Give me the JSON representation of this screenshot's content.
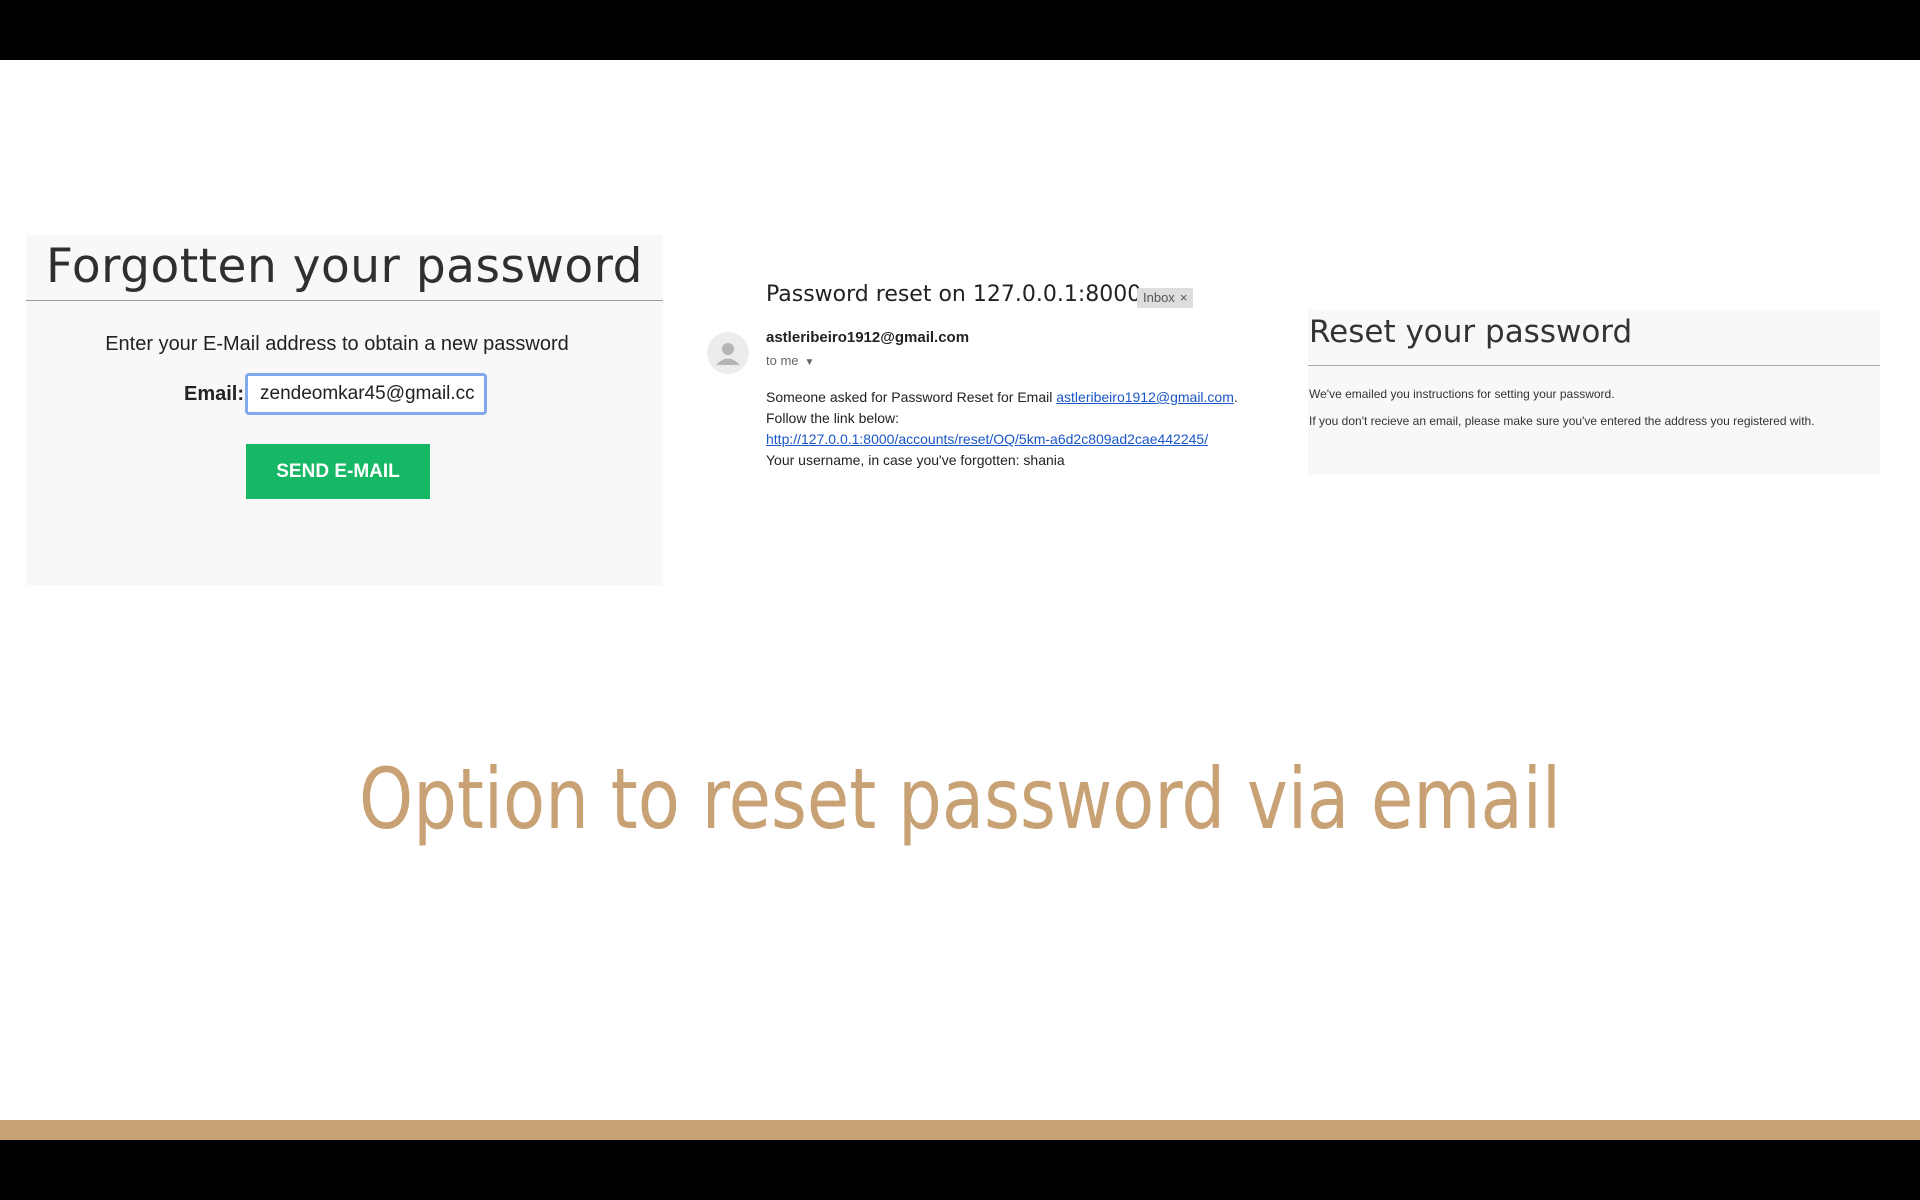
{
  "forgot_panel": {
    "title": "Forgotten your password",
    "instruction": "Enter your E-Mail address to obtain a new password",
    "email_label": "Email:",
    "email_value": "zendeomkar45@gmail.cc",
    "send_button": "SEND E-MAIL",
    "colors": {
      "button": "#17b865",
      "input_focus": "#7fa9e8"
    }
  },
  "email_panel": {
    "subject": "Password reset on 127.0.0.1:8000",
    "tag": "Inbox",
    "tag_close": "×",
    "sender": "astleribeiro1912@gmail.com",
    "recipient": "to me",
    "line1_prefix": "Someone asked for Password Reset for Email ",
    "line1_link": "astleribeiro1912@gmail.com",
    "line1_suffix": ".",
    "line2": "Follow the link below:",
    "reset_link": "http://127.0.0.1:8000/accounts/reset/OQ/5km-a6d2c809ad2cae442245/",
    "line4": "Your username, in case you've forgotten: shania",
    "icons": {
      "avatar": "person-icon",
      "recipient_menu": "caret-down-icon"
    }
  },
  "reset_panel": {
    "title": "Reset your password",
    "line1": "We've emailed you instructions for setting your password.",
    "line2": "If you don't recieve an email, please make sure you've entered the address you registered with."
  },
  "caption": "Option to reset password via email",
  "colors": {
    "accent": "#c8a275",
    "link": "#1a56c8"
  }
}
